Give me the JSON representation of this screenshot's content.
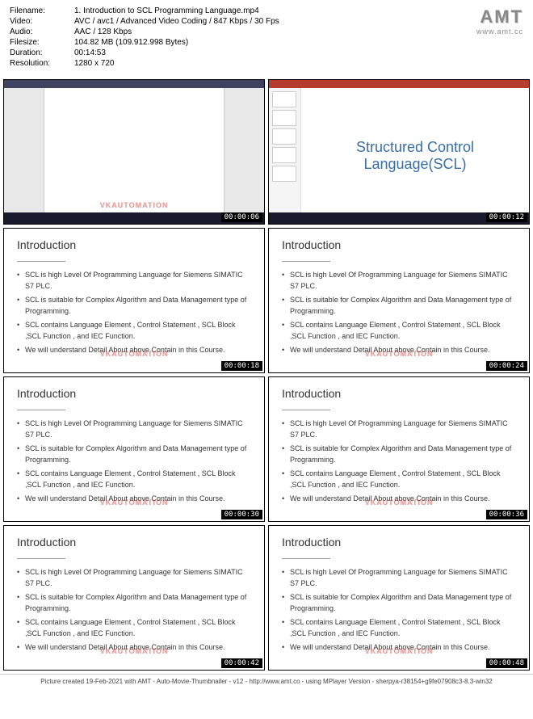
{
  "header": {
    "filename_label": "Filename:",
    "filename": "1. Introduction to SCL Programming Language.mp4",
    "video_label": "Video:",
    "video": "AVC / avc1 / Advanced Video Coding / 847 Kbps / 30 Fps",
    "audio_label": "Audio:",
    "audio": "AAC / 128 Kbps",
    "filesize_label": "Filesize:",
    "filesize": "104.82 MB (109.912.998 Bytes)",
    "duration_label": "Duration:",
    "duration": "00:14:53",
    "resolution_label": "Resolution:",
    "resolution": "1280 x 720"
  },
  "logo": {
    "text": "AMT",
    "sub": "www.amt.cc"
  },
  "ppt_title": "Structured Control Language(SCL)",
  "intro": {
    "title": "Introduction",
    "bullets": [
      "SCL is high Level Of Programming Language for Siemens SIMATIC S7 PLC.",
      "SCL is suitable for Complex Algorithm and Data Management type of Programming.",
      "SCL contains Language Element , Control Statement , SCL Block ,SCL Function , and IEC Function.",
      "We will understand Detail About above Contain in this Course."
    ]
  },
  "watermark": "VKAUTOMATION",
  "timestamps": [
    "00:00:06",
    "00:00:12",
    "00:00:18",
    "00:00:24",
    "00:00:30",
    "00:00:36",
    "00:00:42",
    "00:00:48"
  ],
  "footer": "Picture created 19-Feb-2021 with AMT - Auto-Movie-Thumbnailer - v12 - http://www.amt.co - using MPlayer Version - sherpya-r38154+g9fe07908c3-8.3-win32"
}
